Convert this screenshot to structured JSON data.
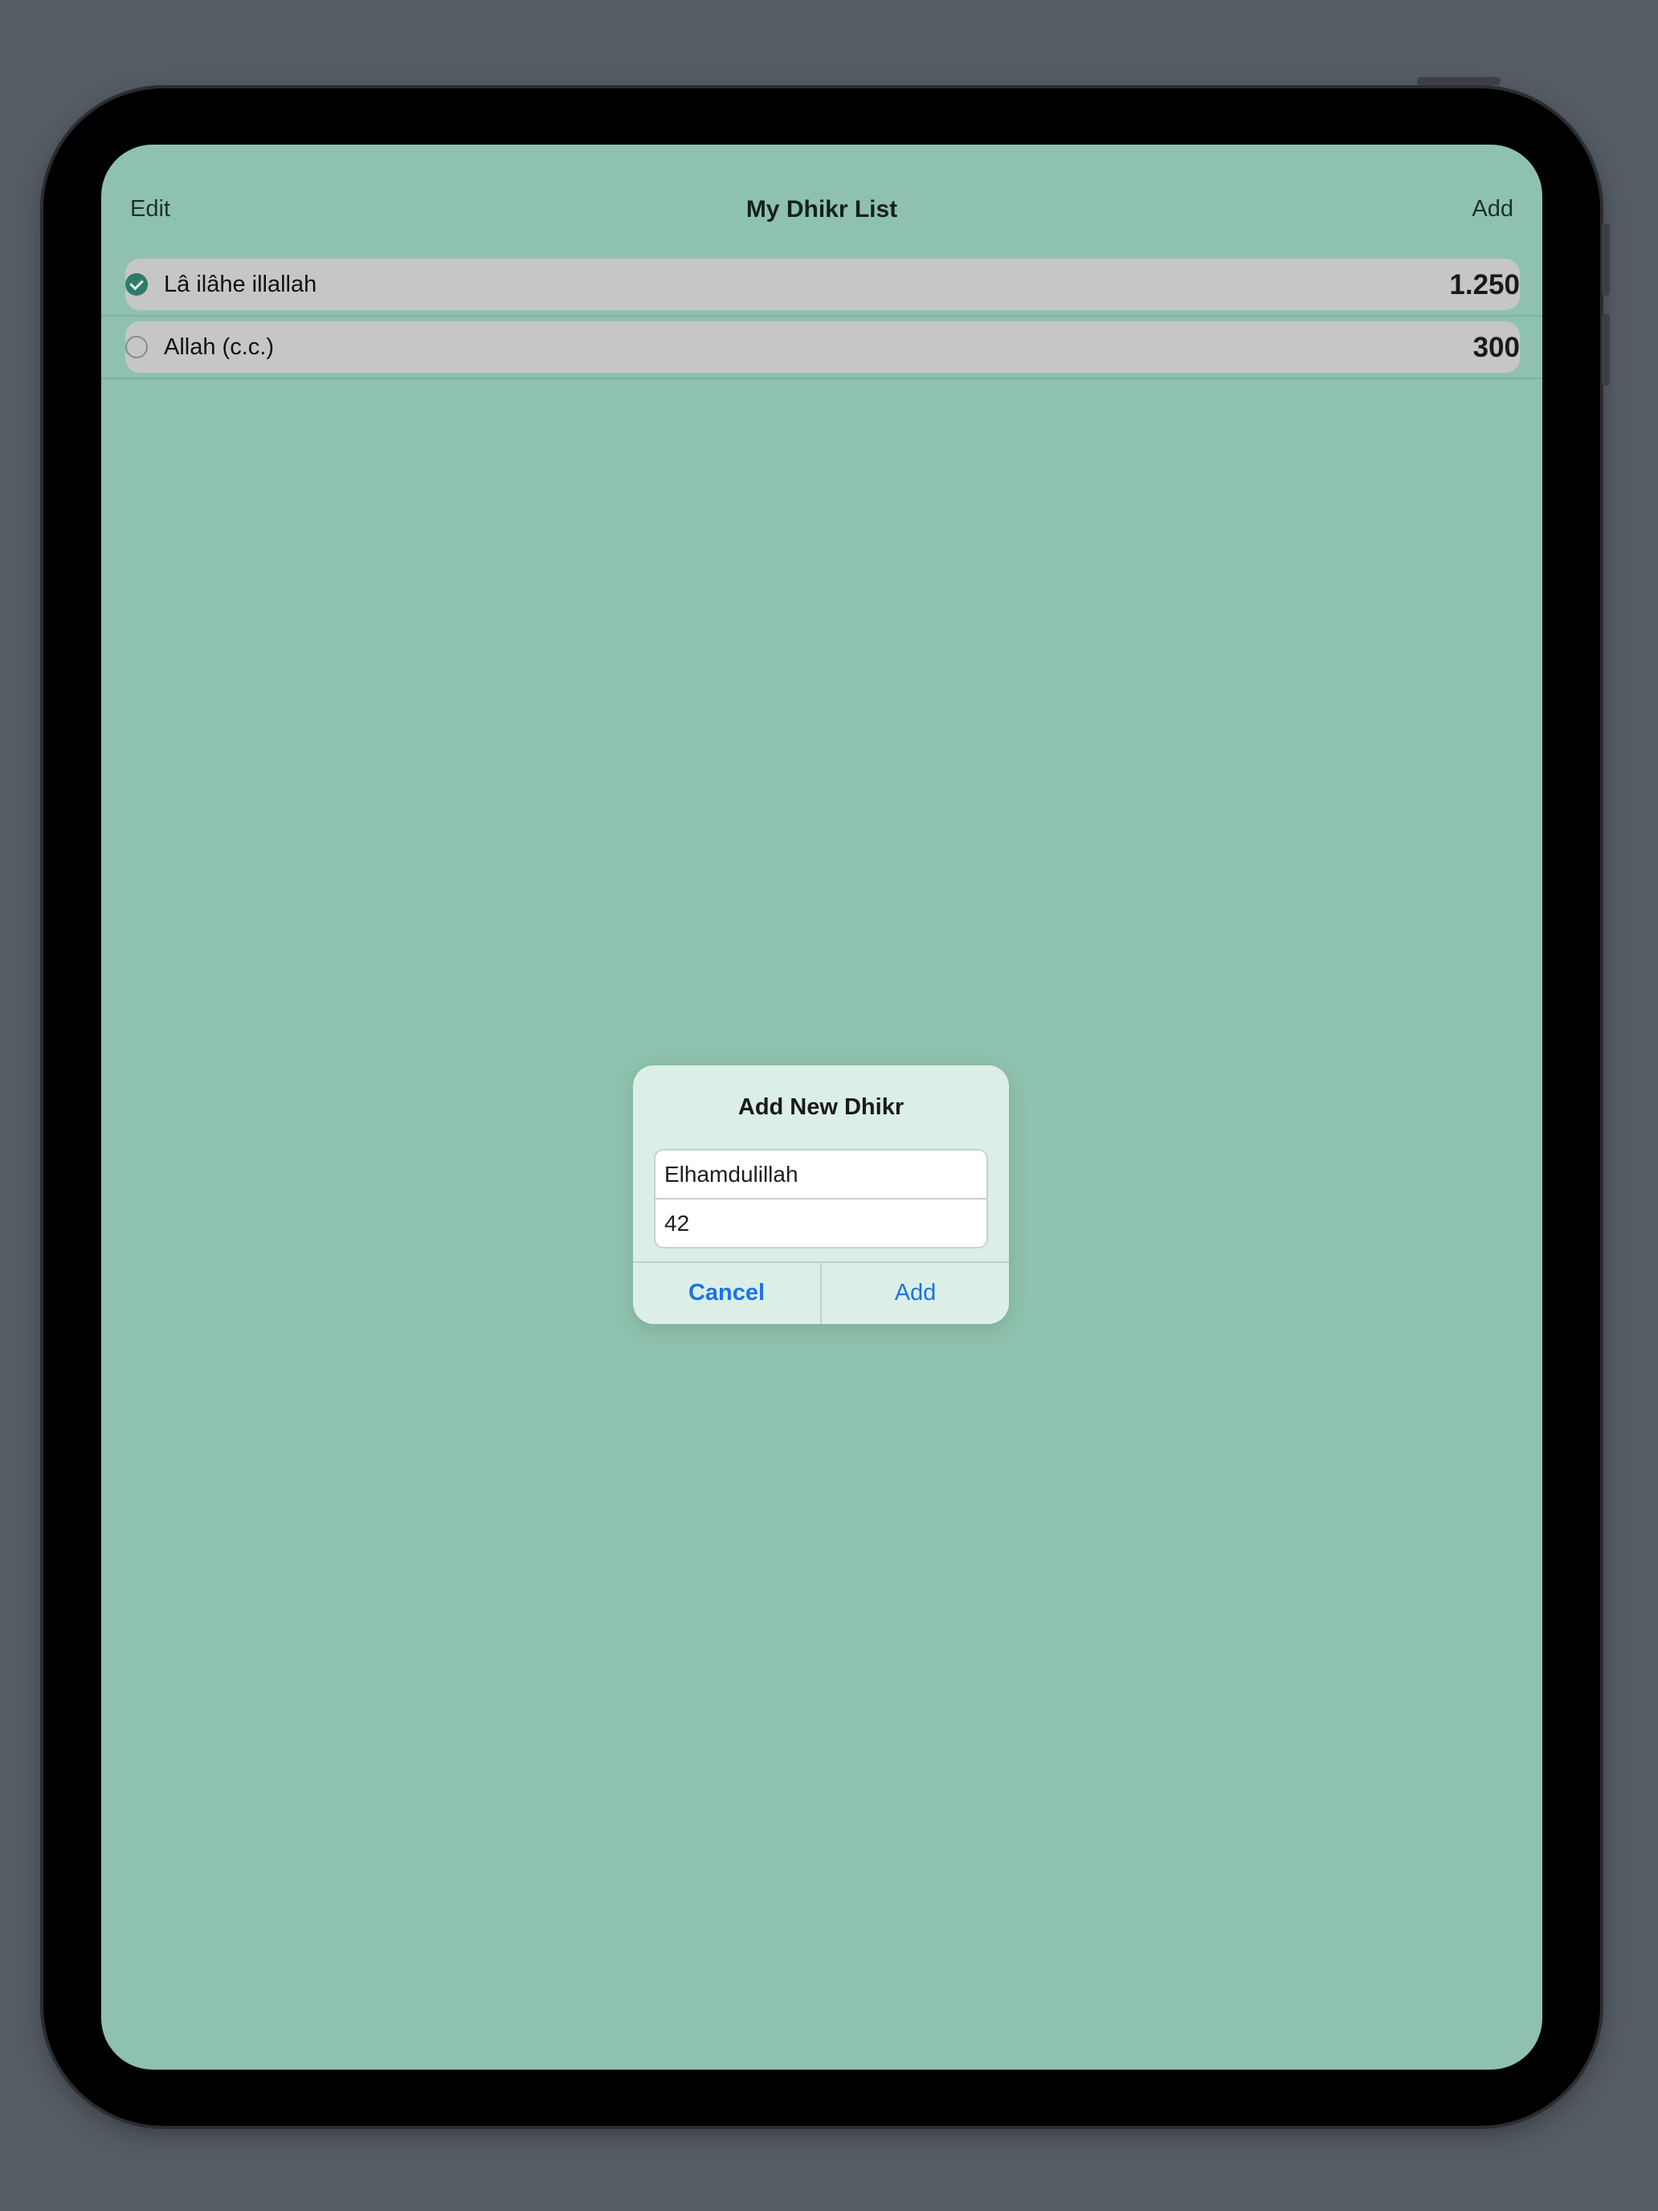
{
  "navbar": {
    "edit_label": "Edit",
    "title": "My Dhikr List",
    "add_label": "Add"
  },
  "list": {
    "items": [
      {
        "label": "Lâ ilâhe illallah",
        "count": "1.250",
        "selected": true
      },
      {
        "label": "Allah (c.c.)",
        "count": "300",
        "selected": false
      }
    ]
  },
  "dialog": {
    "title": "Add New Dhikr",
    "name_value": "Elhamdulillah",
    "count_value": "42",
    "cancel_label": "Cancel",
    "add_label": "Add"
  },
  "colors": {
    "screen_background": "#8fc2ae",
    "accent": "#1a73e8",
    "check_selected": "#2f7a68"
  }
}
